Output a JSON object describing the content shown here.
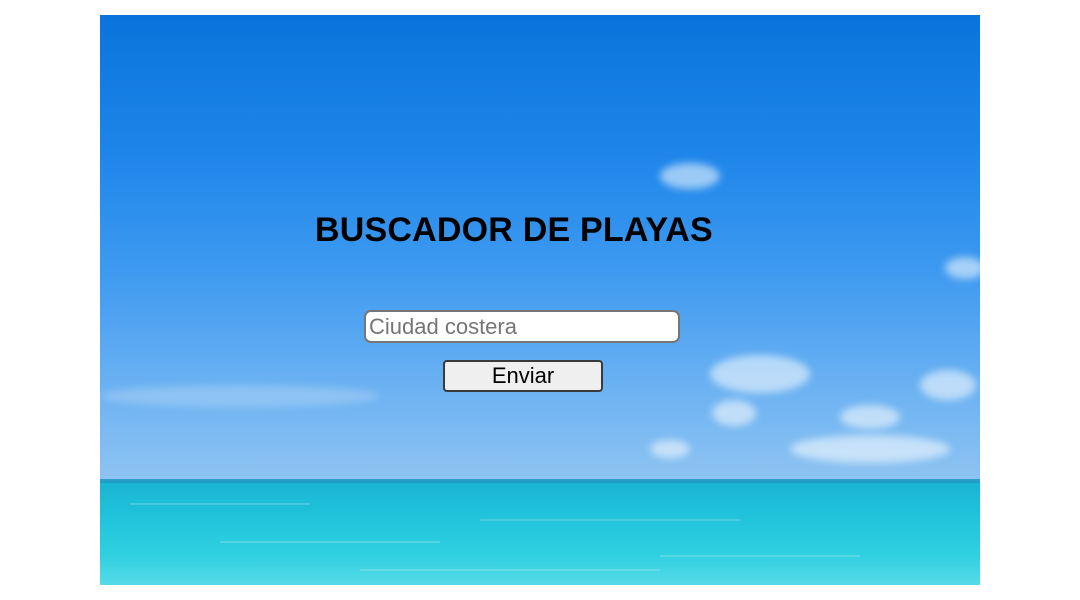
{
  "page": {
    "title": "BUSCADOR DE PLAYAS"
  },
  "search": {
    "value": "",
    "placeholder": "Ciudad costera"
  },
  "actions": {
    "submit_label": "Enviar"
  },
  "colors": {
    "sky_top": "#0a74dc",
    "sky_bottom": "#8fc4f2",
    "sea": "#1fc2da",
    "button_bg": "#efefef",
    "text": "#000000"
  }
}
